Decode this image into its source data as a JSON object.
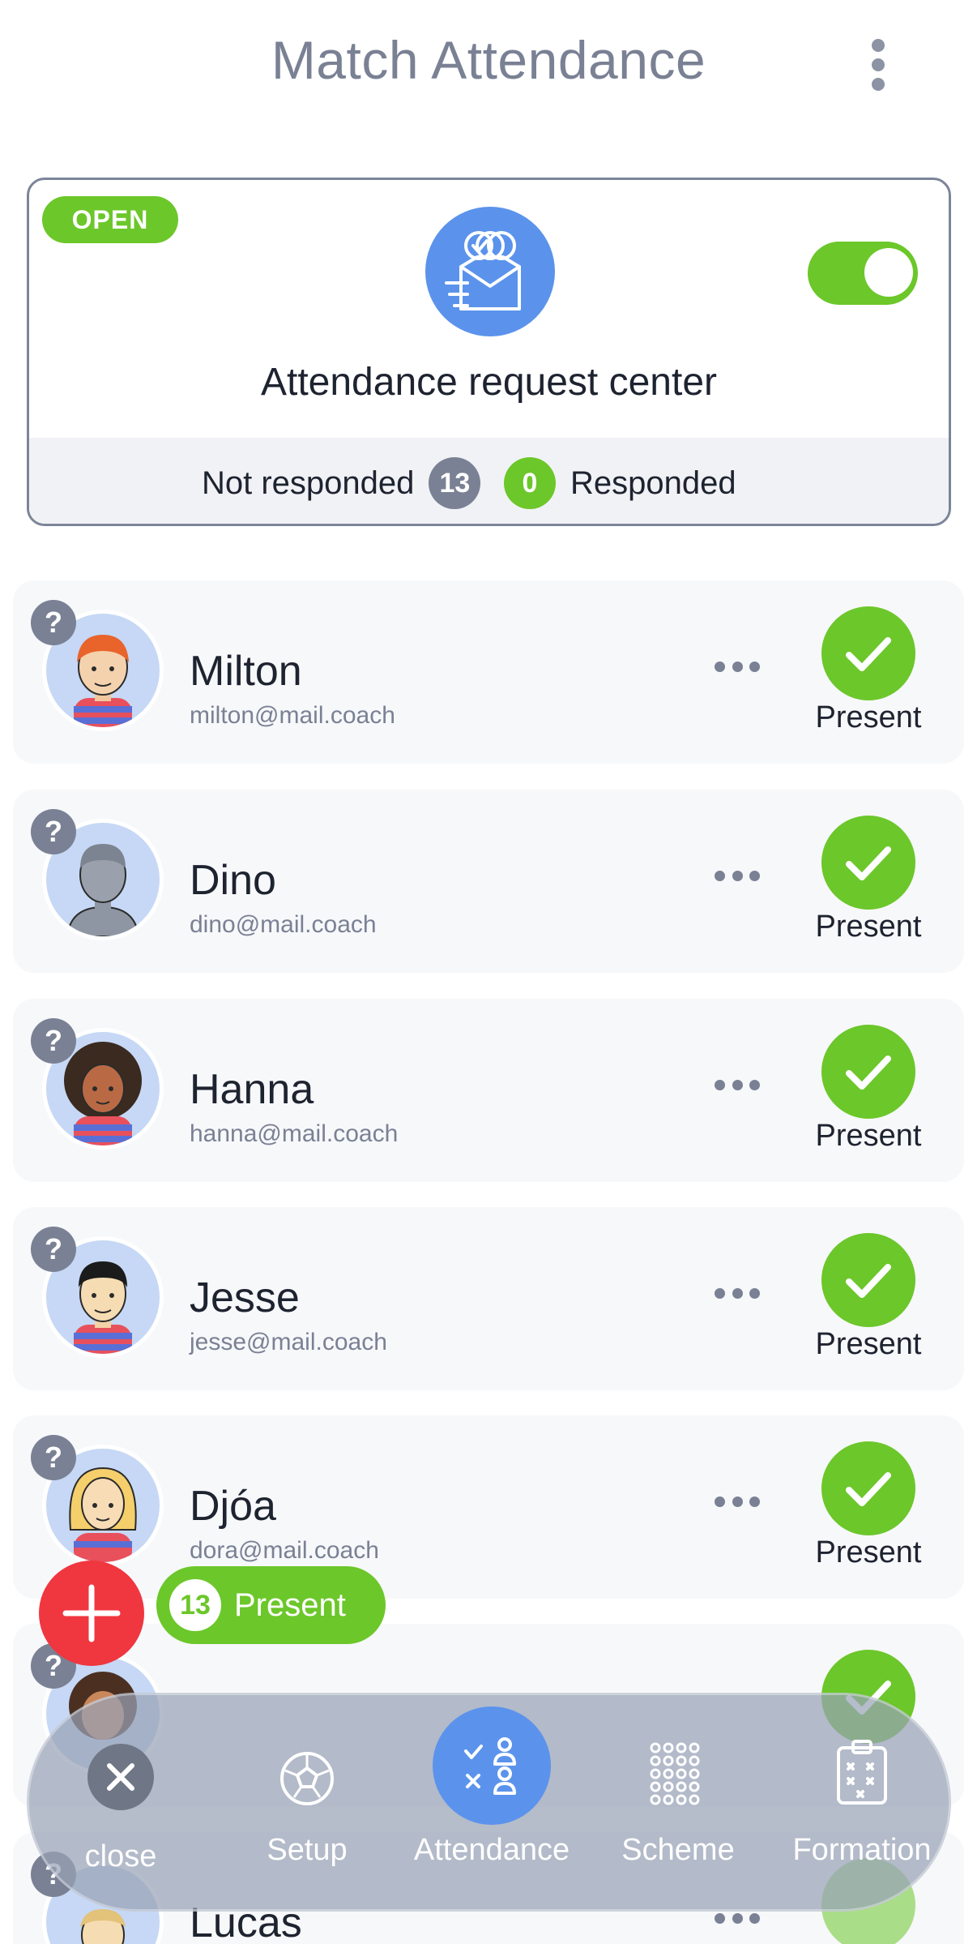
{
  "header": {
    "title": "Match Attendance"
  },
  "request_center": {
    "status_badge": "OPEN",
    "title": "Attendance request center",
    "toggle_on": true,
    "not_responded_label": "Not responded",
    "not_responded_count": "13",
    "responded_count": "0",
    "responded_label": "Responded"
  },
  "players": [
    {
      "name": "Milton",
      "email": "milton@mail.coach",
      "status": "Present",
      "badge": "?"
    },
    {
      "name": "Dino",
      "email": "dino@mail.coach",
      "status": "Present",
      "badge": "?"
    },
    {
      "name": "Hanna",
      "email": "hanna@mail.coach",
      "status": "Present",
      "badge": "?"
    },
    {
      "name": "Jesse",
      "email": "jesse@mail.coach",
      "status": "Present",
      "badge": "?"
    },
    {
      "name": "Djóa",
      "email": "dora@mail.coach",
      "status": "Present",
      "badge": "?"
    },
    {
      "name": "",
      "email": "",
      "status": "",
      "badge": "?"
    },
    {
      "name": "Lucas",
      "email": "",
      "status": "",
      "badge": "?"
    }
  ],
  "present_summary": {
    "count": "13",
    "label": "Present"
  },
  "nav": {
    "close": "close",
    "setup": "Setup",
    "attendance": "Attendance",
    "scheme": "Scheme",
    "formation": "Formation"
  },
  "colors": {
    "accent_green": "#6cc72a",
    "accent_blue": "#5b93ec",
    "danger_red": "#f0363f",
    "muted_gray": "#7a8194"
  }
}
